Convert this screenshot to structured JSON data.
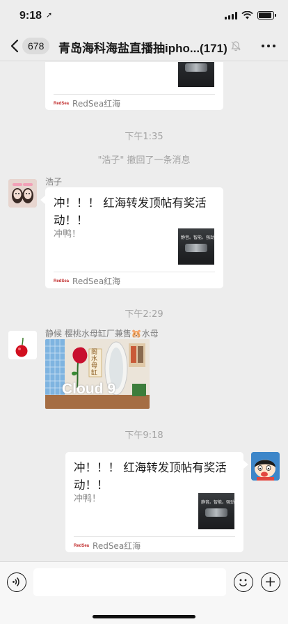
{
  "status_bar": {
    "time": "9:18",
    "location_glyph": "➚",
    "battery_level": 0.9
  },
  "nav": {
    "unread_count": "678",
    "title": "青岛海科海盐直播抽iphо...",
    "member_count": "(171)"
  },
  "messages": {
    "card_top": {
      "source": "RedSea红海"
    },
    "time_1": "下午1:35",
    "recall_notice": "\"浩子\" 撤回了一条消息",
    "haozi_card": {
      "sender": "浩子",
      "title": "冲！！！ 红海转发顶帖有奖活动！！",
      "desc": "冲鸭！",
      "thumb_text": "静音。智能。强劲",
      "source": "RedSea红海"
    },
    "time_2": "下午2:29",
    "jinghou_photo": {
      "sender": "静候   樱桃水母缸厂兼售🐹水母",
      "sign_text": "Cloud 9",
      "sign_chars": "阁 水 母 缸"
    },
    "time_3": "下午9:18",
    "my_card": {
      "title": "冲！！！ 红海转发顶帖有奖活动！！",
      "desc": "冲鸭！",
      "thumb_text": "静音。智能。强劲",
      "source": "RedSea红海"
    }
  },
  "input": {
    "placeholder": ""
  },
  "colors": {
    "background": "#ededed",
    "bubble": "#ffffff",
    "meta_text": "#a3a3a3",
    "brand_red": "#c02a2a"
  },
  "icons": [
    "back-chevron-icon",
    "mute-bell-icon",
    "more-dots-icon",
    "voice-icon",
    "emoji-icon",
    "plus-icon"
  ]
}
